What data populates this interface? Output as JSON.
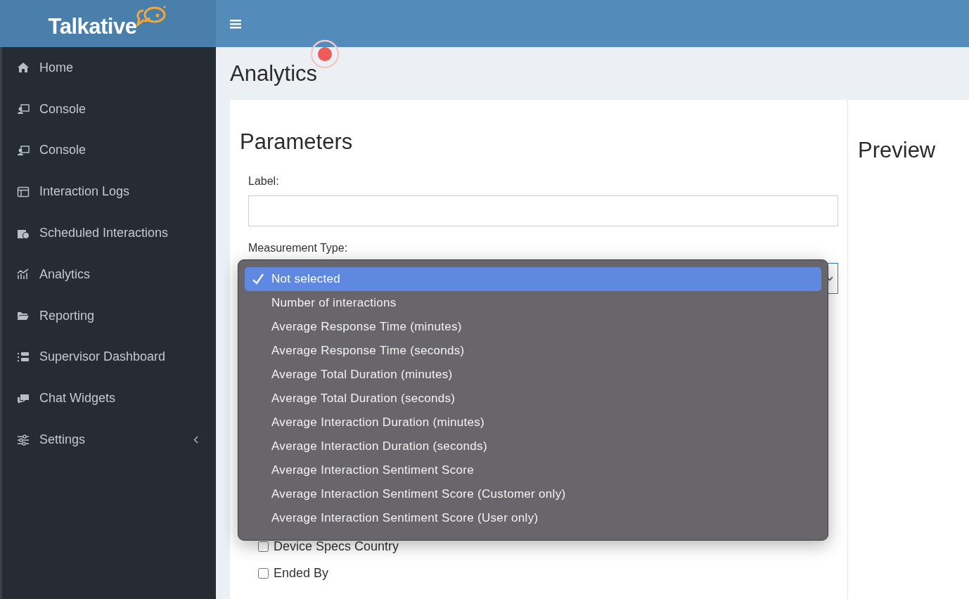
{
  "brand": {
    "name": "Talkative"
  },
  "sidebar": {
    "items": [
      {
        "label": "Home",
        "submenu": false
      },
      {
        "label": "Console",
        "submenu": false
      },
      {
        "label": "Console",
        "submenu": false
      },
      {
        "label": "Interaction Logs",
        "submenu": false
      },
      {
        "label": "Scheduled Interactions",
        "submenu": false
      },
      {
        "label": "Analytics",
        "submenu": false
      },
      {
        "label": "Reporting",
        "submenu": false
      },
      {
        "label": "Supervisor Dashboard",
        "submenu": false
      },
      {
        "label": "Chat Widgets",
        "submenu": false
      },
      {
        "label": "Settings",
        "submenu": true
      }
    ]
  },
  "page": {
    "title": "Analytics"
  },
  "parameters": {
    "heading": "Parameters",
    "label_field": {
      "label": "Label:"
    },
    "measurement_type": {
      "label": "Measurement Type:",
      "options": [
        {
          "label": "Not selected",
          "selected": true
        },
        {
          "label": "Number of interactions",
          "selected": false
        },
        {
          "label": "Average Response Time (minutes)",
          "selected": false
        },
        {
          "label": "Average Response Time (seconds)",
          "selected": false
        },
        {
          "label": "Average Total Duration (minutes)",
          "selected": false
        },
        {
          "label": "Average Total Duration (seconds)",
          "selected": false
        },
        {
          "label": "Average Interaction Duration (minutes)",
          "selected": false
        },
        {
          "label": "Average Interaction Duration (seconds)",
          "selected": false
        },
        {
          "label": "Average Interaction Sentiment Score",
          "selected": false
        },
        {
          "label": "Average Interaction Sentiment Score (Customer only)",
          "selected": false
        },
        {
          "label": "Average Interaction Sentiment Score (User only)",
          "selected": false
        }
      ]
    },
    "checkboxes": [
      {
        "label": "Device Specs Country",
        "checked": false
      },
      {
        "label": "Ended By",
        "checked": false
      }
    ]
  },
  "preview": {
    "heading": "Preview"
  }
}
